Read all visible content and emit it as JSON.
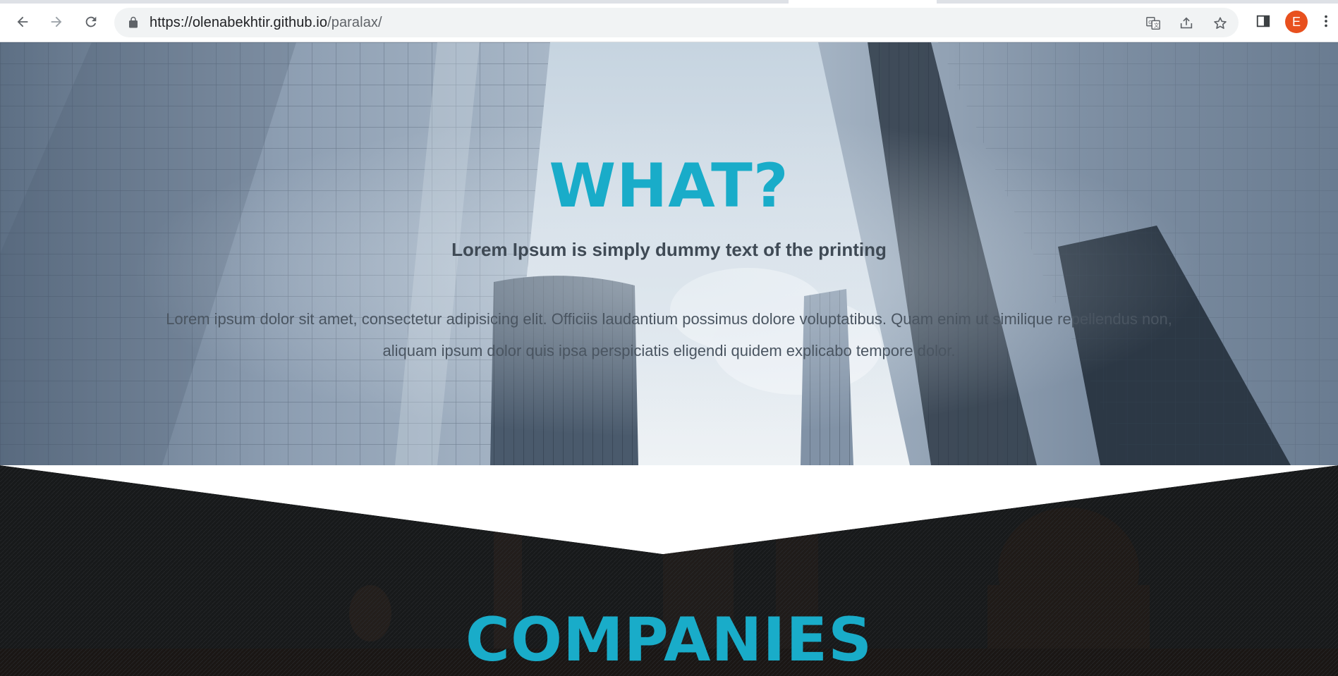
{
  "browser": {
    "url_host": "https://olenabekhtir.github.io",
    "url_path": "/paralax/",
    "profile_initial": "E",
    "icons": [
      "back-arrow-icon",
      "forward-arrow-icon",
      "reload-icon",
      "lock-icon",
      "translate-icon",
      "share-icon",
      "star-icon",
      "side-panel-icon",
      "more-vert-icon"
    ]
  },
  "hero": {
    "title": "WHAT?",
    "subtitle": "Lorem Ipsum is simply dummy text of the printing",
    "body": "Lorem ipsum dolor sit amet, consectetur adipisicing elit. Officiis laudantium possimus dolore voluptatibus. Quam enim ut similique repellendus non, aliquam ipsum dolor quis ipsa perspiciatis eligendi quidem explicabo tempore dolor."
  },
  "companies": {
    "title": "COMPANIES"
  },
  "colors": {
    "accent": "#19acc9",
    "avatar": "#e8501e",
    "dark_section": "#181a1b"
  }
}
